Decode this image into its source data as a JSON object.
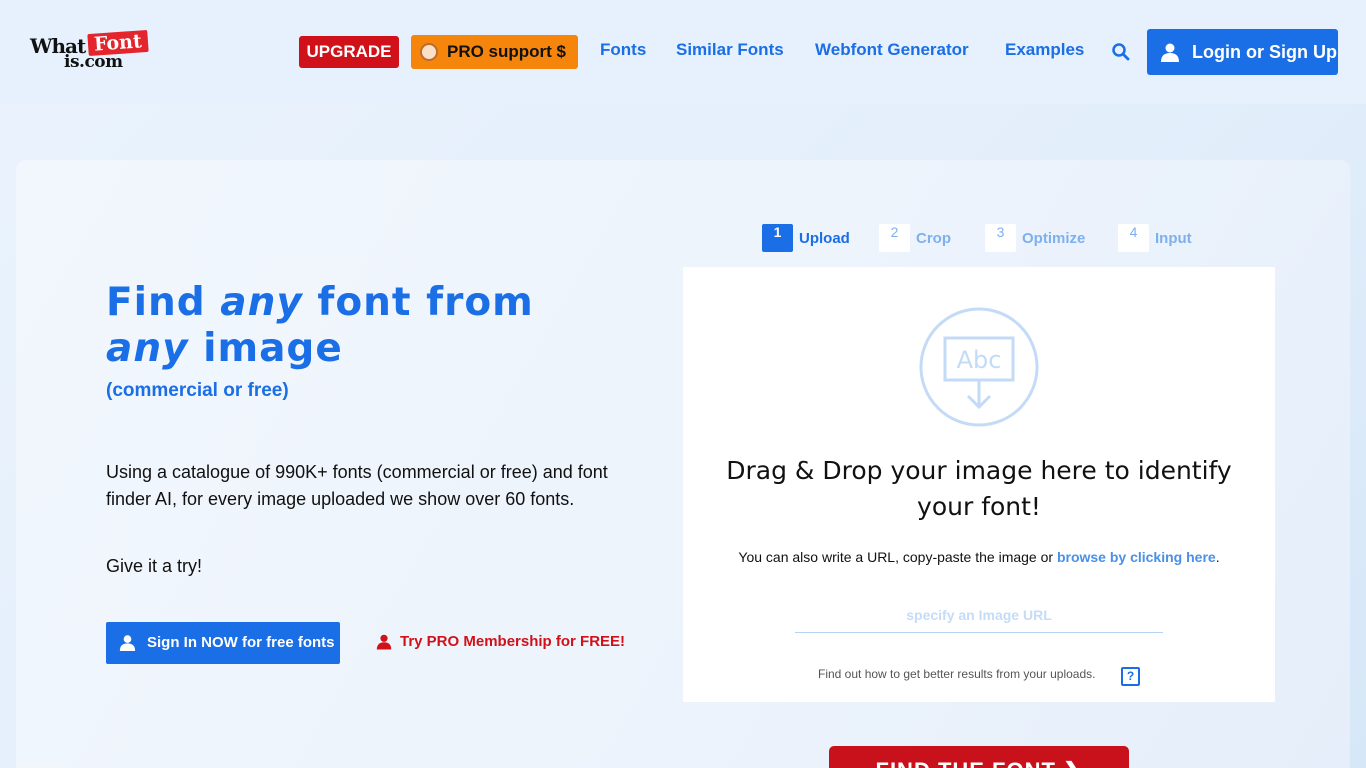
{
  "header": {
    "logo": {
      "what": "What",
      "font": "Font",
      "iscom": "is.com"
    },
    "upgrade_label": "UPGRADE",
    "pro_support_label": "PRO support $",
    "nav": [
      "Fonts",
      "Similar Fonts",
      "Webfont Generator",
      "Examples"
    ],
    "login_label": "Login or Sign Up"
  },
  "hero": {
    "headline_1": "Find ",
    "headline_any_1": "any",
    "headline_2": " font from ",
    "headline_any_2": "any",
    "headline_3": " image",
    "subhead": "(commercial or free)",
    "description": "Using a catalogue of 990K+ fonts (commercial or free) and font finder AI, for every image uploaded we show over 60 fonts.",
    "try_text": "Give it a try!",
    "signin_label": "Sign In NOW for free fonts",
    "try_pro_label": "Try PRO Membership for FREE!"
  },
  "steps": [
    {
      "num": "1",
      "label": "Upload",
      "active": true
    },
    {
      "num": "2",
      "label": "Crop",
      "active": false
    },
    {
      "num": "3",
      "label": "Optimize",
      "active": false
    },
    {
      "num": "4",
      "label": "Input",
      "active": false
    }
  ],
  "upload": {
    "icon": "abc-download-icon",
    "title": "Drag & Drop your image here to identify your font!",
    "sub_prefix": "You can also write a URL, copy-paste the image or ",
    "sub_link": "browse by clicking here",
    "sub_suffix": ".",
    "url_placeholder": "specify an Image URL",
    "hint": "Find out how to get better results from your uploads.",
    "help_label": "?"
  },
  "find_button_label": "FIND THE FONT ❯",
  "colors": {
    "accent": "#1a6ee6",
    "upgrade": "#d1111a",
    "pro": "#f5860b"
  }
}
